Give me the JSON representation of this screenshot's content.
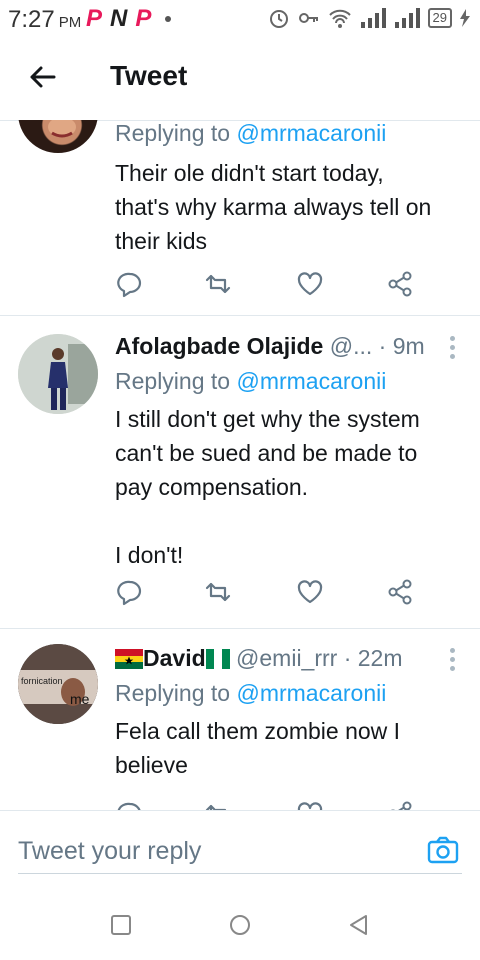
{
  "status_bar": {
    "time": "7:27",
    "ampm": "PM",
    "apps": [
      "P",
      "N",
      "P"
    ],
    "battery": "29"
  },
  "header": {
    "title": "Tweet"
  },
  "tweets": [
    {
      "name": "",
      "handle": "",
      "time": "",
      "replying_label": "Replying to",
      "replying_handle": "@mrmacaronii",
      "text": "Their ole didn't start today,\nthat's why karma always tell on\ntheir kids"
    },
    {
      "name": "Afolagbade Olajide",
      "handle": "@...",
      "time": "· 9m",
      "replying_label": "Replying to",
      "replying_handle": "@mrmacaronii",
      "text": "I still don't get why the system\ncan't be sued and be made to\npay compensation.\n\nI don't!"
    },
    {
      "name": "David",
      "handle": "@emii_rrr",
      "time": "· 22m",
      "replying_label": "Replying to",
      "replying_handle": "@mrmacaronii",
      "text": "Fela call them zombie now I\nbelieve",
      "avatar_caption_1": "fornication",
      "avatar_caption_2": "me"
    }
  ],
  "reply_bar": {
    "placeholder": "Tweet your reply"
  },
  "colors": {
    "accent": "#1da1f2",
    "muted": "#657786",
    "text": "#14171a",
    "divider": "#e1e8ed"
  }
}
